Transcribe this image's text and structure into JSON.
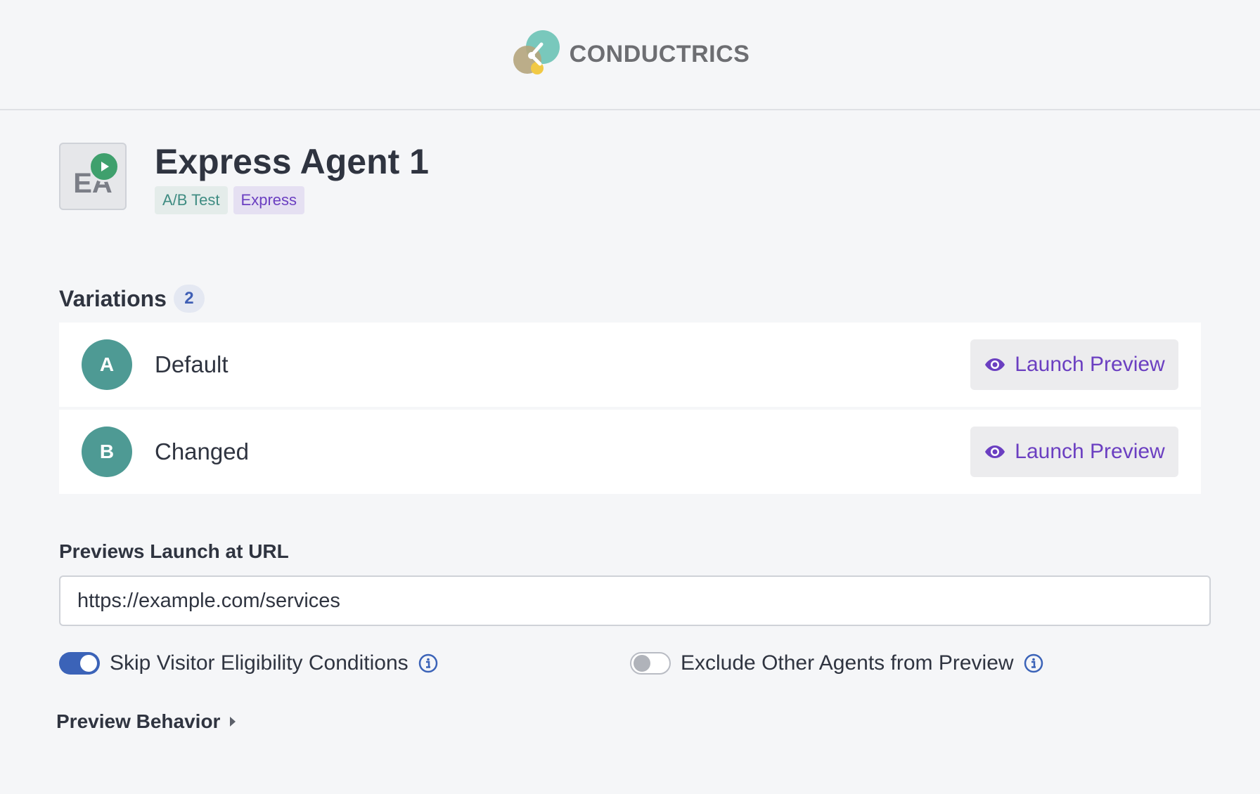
{
  "header": {
    "logo_text": "CONDUCTRICS",
    "logo_icon": "conductrics-logo-icon"
  },
  "agent": {
    "initials": "EA",
    "title": "Express Agent 1",
    "status_icon": "play-icon",
    "tags": [
      "A/B Test",
      "Express"
    ]
  },
  "variations": {
    "title": "Variations",
    "count": "2",
    "items": [
      {
        "letter": "A",
        "name": "Default",
        "button_label": "Launch Preview"
      },
      {
        "letter": "B",
        "name": "Changed",
        "button_label": "Launch Preview"
      }
    ]
  },
  "url": {
    "label": "Previews Launch at URL",
    "value": "https://example.com/services"
  },
  "toggles": {
    "skip_label": "Skip Visitor Eligibility Conditions",
    "skip_on": true,
    "exclude_label": "Exclude Other Agents from Preview",
    "exclude_on": false
  },
  "behavior": {
    "label": "Preview Behavior"
  },
  "colors": {
    "accent_purple": "#6b3fc1",
    "teal": "#4e9a94",
    "toggle_blue": "#3b63b8",
    "play_green": "#3fa06d"
  }
}
